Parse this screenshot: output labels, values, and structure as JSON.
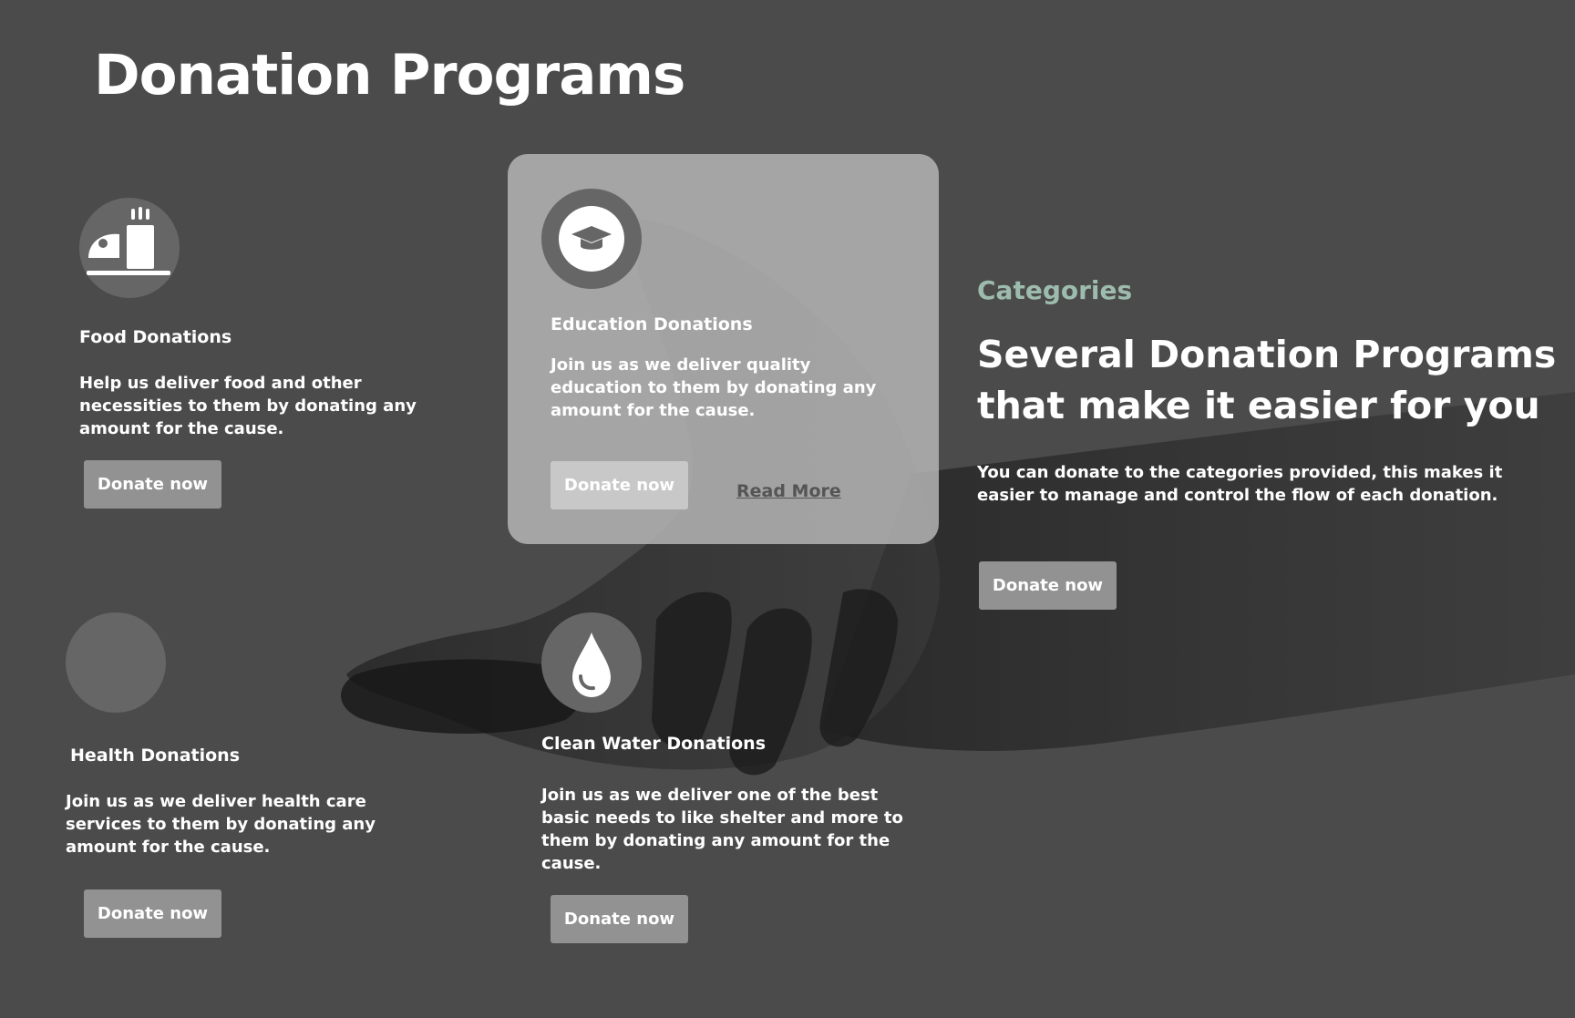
{
  "page": {
    "title": "Donation Programs"
  },
  "programs": [
    {
      "id": "food",
      "icon": "food-icon",
      "title": "Food Donations",
      "description": "Help us deliver food and other necessities to them by donating any amount for the cause.",
      "button_label": "Donate now"
    },
    {
      "id": "education",
      "icon": "graduation-cap-icon",
      "title": "Education Donations",
      "description": "Join us as we deliver quality education to them by donating any amount for the cause.",
      "button_label": "Donate now",
      "link_label": "Read More",
      "highlighted": true
    },
    {
      "id": "health",
      "icon": "health-icon",
      "title": "Health Donations",
      "description": "Join us as we deliver health care services to them by donating any amount for the cause.",
      "button_label": "Donate now"
    },
    {
      "id": "water",
      "icon": "water-drop-icon",
      "title": "Clean Water Donations",
      "description": "Join us as we deliver one of the best basic needs to like shelter and more to them by donating any amount for the cause.",
      "button_label": "Donate now"
    }
  ],
  "categories": {
    "eyebrow": "Categories",
    "heading": "Several Donation Programs that make it easier for you",
    "description": "You can donate to the categories provided, this makes it easier to manage and control the flow of each donation.",
    "button_label": "Donate now"
  },
  "colors": {
    "background": "#4b4b4b",
    "accent_green": "#9dbcae",
    "button_gray": "#929292",
    "card_gray": "#b9b9b9"
  }
}
